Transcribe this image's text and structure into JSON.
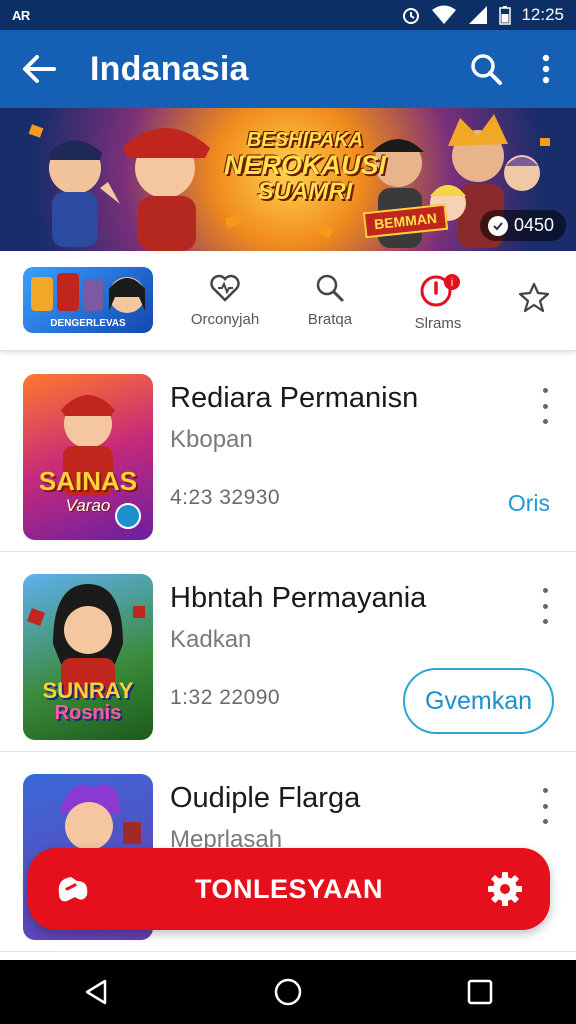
{
  "status_bar": {
    "left_text": "AR",
    "time": "12:25"
  },
  "app_bar": {
    "title": "Indanasia"
  },
  "banner": {
    "line1": "BESHIPAKA",
    "line2": "NEROKAUSI",
    "line3": "SUAMRI",
    "stamp": "BEMMAN",
    "badge": "0450"
  },
  "categories": {
    "thumb_label": "DENGERLEVAS",
    "items": [
      {
        "label": "Orconyjah",
        "icon": "heart-outline-icon"
      },
      {
        "label": "Bratqa",
        "icon": "search-icon"
      },
      {
        "label": "Slrams",
        "icon": "power-icon"
      },
      {
        "label": "",
        "icon": "star-outline-icon"
      }
    ]
  },
  "games": [
    {
      "title": "Rediara Permanisn",
      "subtitle": "Kbopan",
      "count": "4:23 32930",
      "action": "Oris",
      "icon_text": "SAINAS",
      "icon_sub": "Varao"
    },
    {
      "title": "Hbntah Permayania",
      "subtitle": "Kadkan",
      "count": "1:32 22090",
      "action": "Gvemkan",
      "icon_text": "SUNRAY",
      "icon_sub": "Rosnis"
    },
    {
      "title": "Oudiple Flarga",
      "subtitle": "Meprlasah",
      "count": "",
      "action": "",
      "icon_text": "",
      "icon_sub": ""
    }
  ],
  "fab": {
    "label": "TONLESYAAN"
  },
  "colors": {
    "app_bar": "#1560b5",
    "status_bar": "#0c2f66",
    "fab": "#e5101c",
    "accent": "#1c9ad6"
  }
}
